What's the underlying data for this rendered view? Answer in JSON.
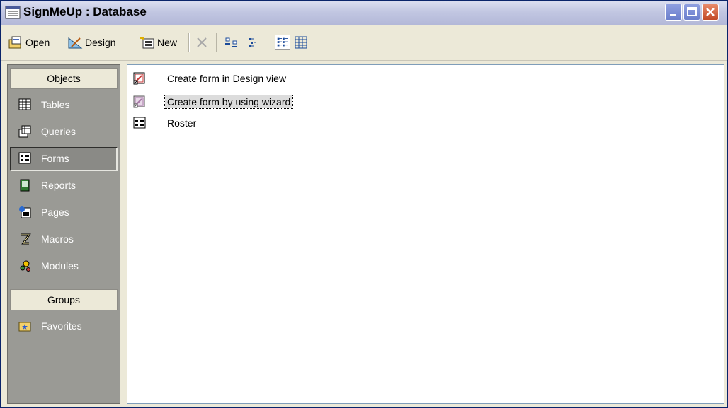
{
  "window": {
    "title": "SignMeUp : Database"
  },
  "toolbar": {
    "open_label": "Open",
    "design_label": "Design",
    "new_label": "New"
  },
  "sidebar": {
    "objects_header": "Objects",
    "items": [
      {
        "label": "Tables",
        "icon": "table-icon",
        "active": false
      },
      {
        "label": "Queries",
        "icon": "query-icon",
        "active": false
      },
      {
        "label": "Forms",
        "icon": "form-icon",
        "active": true
      },
      {
        "label": "Reports",
        "icon": "report-icon",
        "active": false
      },
      {
        "label": "Pages",
        "icon": "page-icon",
        "active": false
      },
      {
        "label": "Macros",
        "icon": "macro-icon",
        "active": false
      },
      {
        "label": "Modules",
        "icon": "module-icon",
        "active": false
      }
    ],
    "groups_header": "Groups",
    "groups": [
      {
        "label": "Favorites",
        "icon": "favorites-folder-icon"
      }
    ]
  },
  "content": {
    "items": [
      {
        "label": "Create form in Design view",
        "icon": "design-view-shortcut-icon",
        "selected": false
      },
      {
        "label": "Create form by using wizard",
        "icon": "wizard-shortcut-icon",
        "selected": true
      },
      {
        "label": "Roster",
        "icon": "form-icon",
        "selected": false
      }
    ]
  },
  "colors": {
    "sidebar_bg": "#9a9a95",
    "titlebar": "#c2c7e2",
    "close_button": "#c24a26"
  }
}
